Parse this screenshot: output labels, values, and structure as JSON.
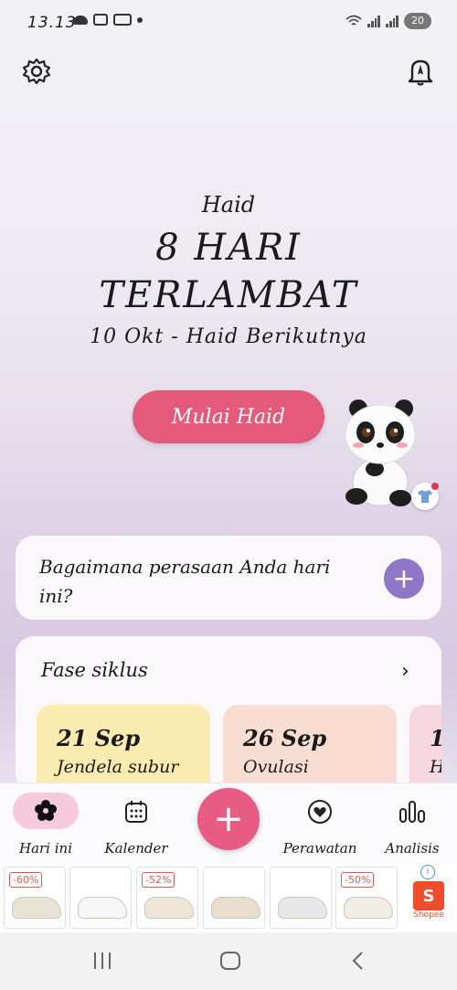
{
  "status_bar": {
    "time": "13.13",
    "battery": "20"
  },
  "header": {
    "settings_icon": "gear-icon",
    "reminder_icon": "bell-icon"
  },
  "hero": {
    "label": "Haid",
    "line1": "8 HARI",
    "line2": "TERLAMBAT",
    "next_period": "10 Okt - Haid Berikutnya",
    "button": "Mulai Haid"
  },
  "mood_card": {
    "question": "Bagaimana perasaan Anda hari ini?"
  },
  "cycle_phase": {
    "title": "Fase siklus",
    "tiles": [
      {
        "date": "21 Sep",
        "label": "Jendela subur",
        "color": "#faecb0"
      },
      {
        "date": "26 Sep",
        "label": "Ovulasi",
        "color": "#f8ddd0"
      },
      {
        "date": "1",
        "label": "H",
        "color": "#f7d7e0"
      }
    ]
  },
  "tabs": [
    {
      "label": "Hari ini",
      "icon": "flower-icon"
    },
    {
      "label": "Kalender",
      "icon": "calendar-icon"
    },
    {
      "label": "Perawatan",
      "icon": "heart-icon"
    },
    {
      "label": "Analisis",
      "icon": "bar-chart-icon"
    }
  ],
  "ads": {
    "discounts": [
      "-60%",
      "-52%",
      "-50%"
    ],
    "brand": "Shopee",
    "brand_letter": "S"
  },
  "colors": {
    "accent": "#e55a7a",
    "purple": "#8f76c6",
    "active_tab": "#f6c9dc"
  }
}
